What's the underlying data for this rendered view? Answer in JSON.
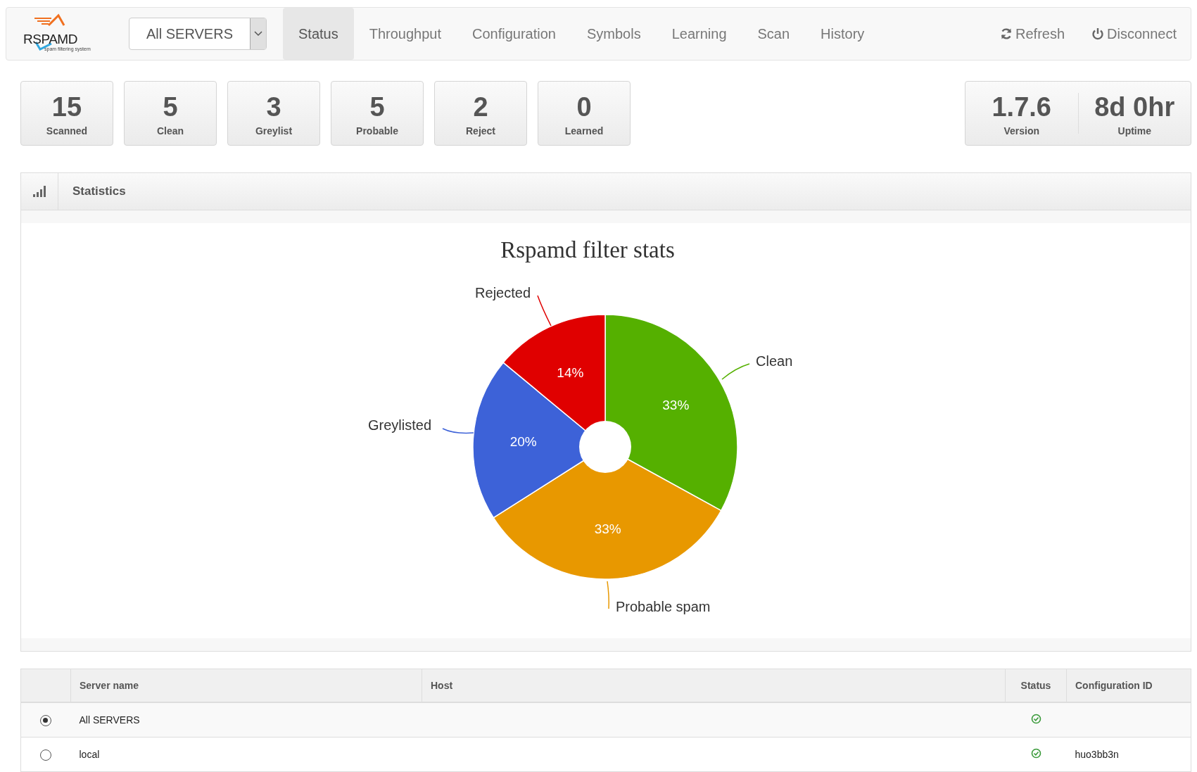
{
  "navbar": {
    "logo": {
      "text": "RSPAMD",
      "subtitle": "spam filtering system"
    },
    "server_select": {
      "value": "All SERVERS"
    },
    "tabs": [
      {
        "label": "Status",
        "selected": true
      },
      {
        "label": "Throughput",
        "selected": false
      },
      {
        "label": "Configuration",
        "selected": false
      },
      {
        "label": "Symbols",
        "selected": false
      },
      {
        "label": "Learning",
        "selected": false
      },
      {
        "label": "Scan",
        "selected": false
      },
      {
        "label": "History",
        "selected": false
      }
    ],
    "actions": [
      {
        "label": "Refresh",
        "kind": "refresh"
      },
      {
        "label": "Disconnect",
        "kind": "power"
      }
    ]
  },
  "stats": [
    {
      "value": "15",
      "label": "Scanned"
    },
    {
      "value": "5",
      "label": "Clean"
    },
    {
      "value": "3",
      "label": "Greylist"
    },
    {
      "value": "5",
      "label": "Probable"
    },
    {
      "value": "2",
      "label": "Reject"
    },
    {
      "value": "0",
      "label": "Learned"
    }
  ],
  "system": [
    {
      "value": "1.7.6",
      "label": "Version"
    },
    {
      "value": "8d 0hr",
      "label": "Uptime"
    }
  ],
  "statistics_panel": {
    "title": "Statistics",
    "chart_data": {
      "type": "pie",
      "title": "Rspamd filter stats",
      "categories": [
        "Clean",
        "Probable spam",
        "Greylisted",
        "Rejected"
      ],
      "values": [
        33,
        33,
        20,
        14
      ],
      "colors": [
        "#55b000",
        "#e89800",
        "#3d62d8",
        "#e00000"
      ],
      "value_labels": [
        "33%",
        "33%",
        "20%",
        "14%"
      ]
    }
  },
  "servers_table": {
    "columns": [
      "Server name",
      "Host",
      "Status",
      "Configuration ID"
    ],
    "rows": [
      {
        "selected": true,
        "server_name": "All SERVERS",
        "status_ok": true
      },
      {
        "selected": false,
        "server_name": "local",
        "status_ok": true,
        "configuration_id": "huo3bb3n"
      }
    ]
  }
}
